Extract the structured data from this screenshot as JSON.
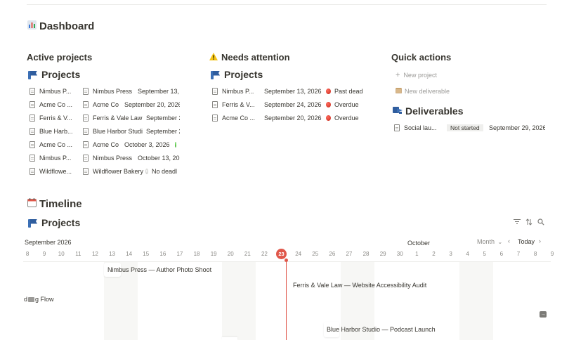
{
  "page": {
    "title": "Dashboard",
    "title_icon": "bar-chart-icon"
  },
  "sections": {
    "active_projects": {
      "heading": "Active projects",
      "db_title": "Projects",
      "rows": [
        {
          "name": "Nimbus P...",
          "client": "Nimbus Press",
          "date": "September 13, 2",
          "status": "",
          "dot": ""
        },
        {
          "name": "Acme Co ...",
          "client": "Acme Co",
          "date": "September 20, 2026",
          "status": "",
          "dot": ""
        },
        {
          "name": "Ferris & V...",
          "client": "Ferris & Vale Law",
          "date": "September 2",
          "status": "",
          "dot": ""
        },
        {
          "name": "Blue Harb...",
          "client": "Blue Harbor Studi",
          "date": "September 2",
          "status": "",
          "dot": ""
        },
        {
          "name": "Acme Co ...",
          "client": "Acme Co",
          "date": "October 3, 2026",
          "status": "",
          "dot": "green"
        },
        {
          "name": "Nimbus P...",
          "client": "Nimbus Press",
          "date": "October 13, 202",
          "status": "",
          "dot": ""
        },
        {
          "name": "Wildflowe...",
          "client": "Wildflower Bakery",
          "date": "",
          "status": "No deadl",
          "dot": "white"
        }
      ]
    },
    "needs_attention": {
      "heading": "Needs attention",
      "heading_icon": "warning-icon",
      "db_title": "Projects",
      "rows": [
        {
          "name": "Nimbus P...",
          "date": "September 13, 2026",
          "status": "Past dead",
          "dot": "red"
        },
        {
          "name": "Ferris & V...",
          "date": "September 24, 2026",
          "status": "Overdue",
          "dot": "red"
        },
        {
          "name": "Acme Co ...",
          "date": "September 20, 2026",
          "status": "Overdue",
          "dot": "red"
        }
      ]
    },
    "quick_actions": {
      "heading": "Quick actions",
      "new_project": "New project",
      "new_deliverable": "New deliverable",
      "db_title": "Deliverables",
      "db_icon": "deliverables-icon",
      "rows": [
        {
          "name": "Social lau...",
          "status": "Not started",
          "date": "September 29, 2026"
        }
      ]
    },
    "timeline": {
      "heading": "Timeline",
      "heading_icon": "calendar-icon",
      "db_title": "Projects",
      "month_left": "September 2026",
      "month_right": "October",
      "view_mode": "Month",
      "today_label": "Today",
      "today_day": "23",
      "days": [
        "8",
        "9",
        "10",
        "11",
        "12",
        "13",
        "14",
        "15",
        "16",
        "17",
        "18",
        "19",
        "20",
        "21",
        "22",
        "23",
        "24",
        "25",
        "26",
        "27",
        "28",
        "29",
        "30",
        "1",
        "2",
        "3",
        "4",
        "5",
        "6",
        "7",
        "8",
        "9"
      ],
      "bars": {
        "nimbus": "Nimbus Press — Author Photo Shoot",
        "ferris": "Ferris & Vale Law — Website Accessibility Audit",
        "offscreen": "g Flow",
        "blueharbor": "Blue Harbor Studio — Podcast Launch"
      }
    }
  },
  "colors": {
    "accent_red": "#e0574a",
    "db_icon_blue": "#2f5d9e",
    "weekend_bg": "#f7f7f5"
  }
}
